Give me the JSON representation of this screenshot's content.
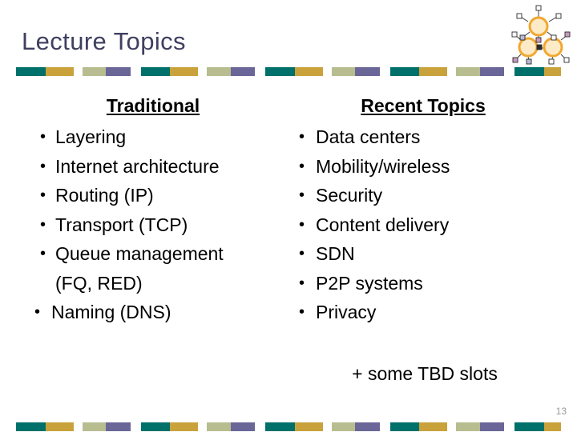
{
  "slide": {
    "title": "Lecture Topics",
    "page_number": "13",
    "title_color": "#3f3f61",
    "body_color": "#000000",
    "page_number_color": "#9a9a9a"
  },
  "decor": {
    "bar_colors": {
      "teal": "#00706b",
      "gold": "#c9a23c",
      "sage": "#b7bd8f",
      "purple": "#6a6698"
    }
  },
  "logo": {
    "name": "network-nodes-logo",
    "node_color": "#f0a830",
    "node_fill": "#fde9c2",
    "handle_colors": [
      "#ffffff",
      "#c99bc1",
      "#b9b9d6"
    ]
  },
  "columns": [
    {
      "id": "traditional",
      "heading": "Traditional",
      "bullet_glyph": "•",
      "items": [
        {
          "text": "Layering"
        },
        {
          "text": "Internet architecture"
        },
        {
          "text": "Routing (IP)"
        },
        {
          "text": "Transport (TCP)"
        },
        {
          "text": "Queue management",
          "continuation": "(FQ, RED)"
        },
        {
          "text": "Naming (DNS)",
          "outdent": true
        }
      ]
    },
    {
      "id": "recent",
      "heading": "Recent Topics",
      "bullet_glyph": "•",
      "items": [
        {
          "text": "Data centers"
        },
        {
          "text": "Mobility/wireless"
        },
        {
          "text": "Security"
        },
        {
          "text": "Content delivery"
        },
        {
          "text": "SDN"
        },
        {
          "text": "P2P systems"
        },
        {
          "text": "Privacy"
        }
      ]
    }
  ],
  "footnote": {
    "text": "+ some TBD slots"
  }
}
